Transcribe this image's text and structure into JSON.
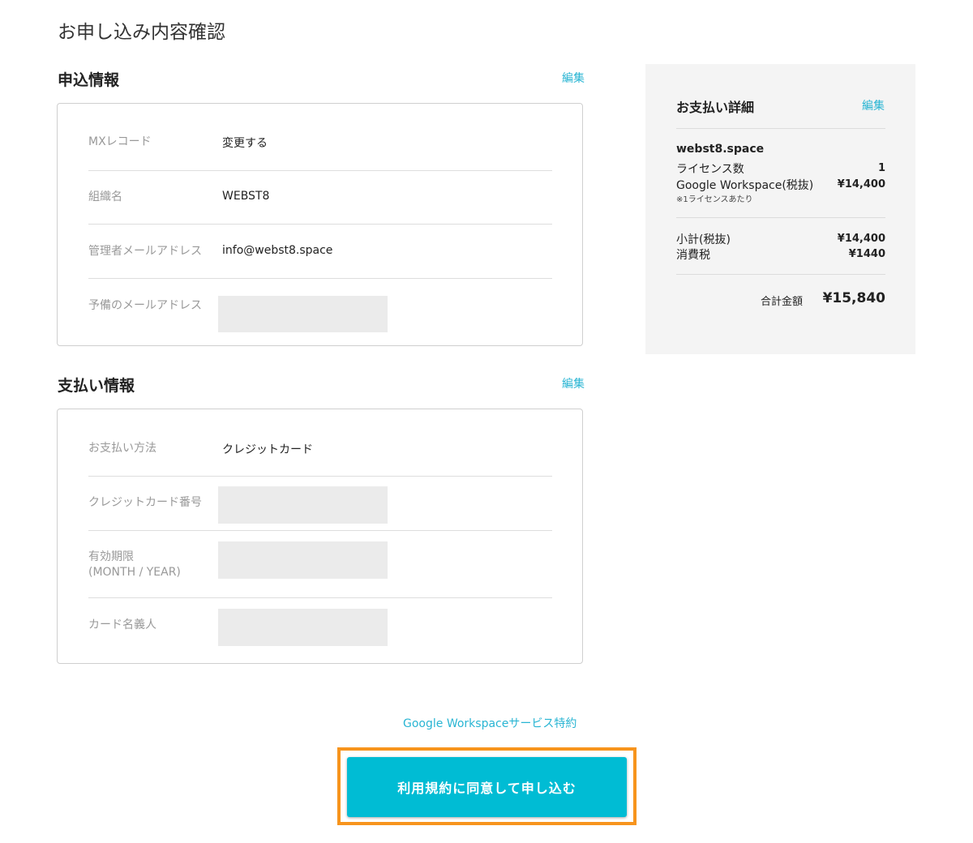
{
  "page_title": "お申し込み内容確認",
  "application_info": {
    "title": "申込情報",
    "edit_label": "編集",
    "rows": [
      {
        "label": "MXレコード",
        "value": "変更する"
      },
      {
        "label": "組織名",
        "value": "WEBST8"
      },
      {
        "label": "管理者メールアドレス",
        "value": "info@webst8.space"
      },
      {
        "label": "予備のメールアドレス",
        "value": ""
      }
    ]
  },
  "payment_info": {
    "title": "支払い情報",
    "edit_label": "編集",
    "rows": [
      {
        "label": "お支払い方法",
        "value": "クレジットカード"
      },
      {
        "label": "クレジットカード番号",
        "value": ""
      },
      {
        "label": "有効期限",
        "label_sub": "(MONTH / YEAR)",
        "value": ""
      },
      {
        "label": "カード名義人",
        "value": ""
      }
    ]
  },
  "payment_detail": {
    "title": "お支払い詳細",
    "edit_label": "編集",
    "domain": "webst8.space",
    "license_label": "ライセンス数",
    "license_count": "1",
    "product_label": "Google Workspace(税抜)",
    "product_price": "¥14,400",
    "product_note": "※1ライセンスあたり",
    "subtotal_label": "小計(税抜)",
    "subtotal_value": "¥14,400",
    "tax_label": "消費税",
    "tax_value": "¥1440",
    "total_label": "合計金額",
    "total_value": "¥15,840"
  },
  "terms_link": "Google Workspaceサービス特約",
  "submit_label": "利用規約に同意して申し込む",
  "colors": {
    "accent": "#29b5d3",
    "button": "#00bcd4",
    "highlight_border": "#f7941d"
  }
}
